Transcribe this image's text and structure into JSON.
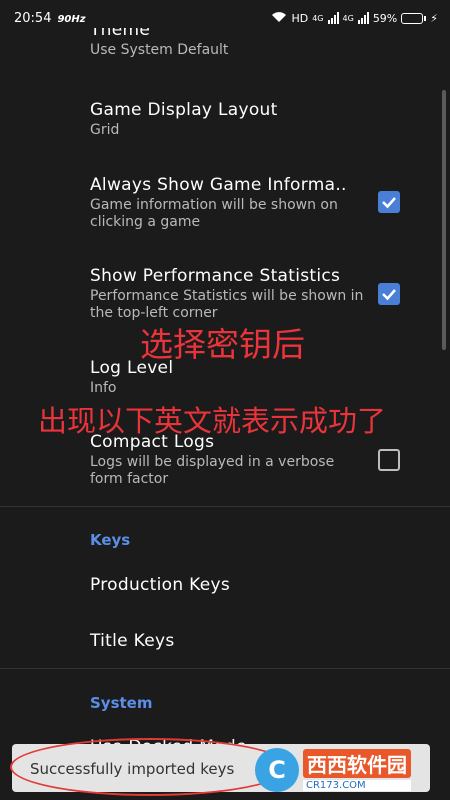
{
  "status_bar": {
    "time": "20:54",
    "refresh_rate": "90Hz",
    "network_label": "HD",
    "net_type_1": "4G",
    "net_type_2": "4G",
    "battery_percent": "59%",
    "battery_level": 0.59
  },
  "settings": {
    "theme": {
      "title": "Theme",
      "value": "Use System Default"
    },
    "game_display_layout": {
      "title": "Game Display Layout",
      "value": "Grid"
    },
    "always_show_game_info": {
      "title": "Always Show Game Informa..",
      "description": "Game information will be shown on clicking a game",
      "checked": true
    },
    "show_performance_stats": {
      "title": "Show Performance Statistics",
      "description": "Performance Statistics will be shown in the top-left corner",
      "checked": true
    },
    "log_level": {
      "title": "Log Level",
      "value": "Info"
    },
    "compact_logs": {
      "title": "Compact Logs",
      "description": "Logs will be displayed in a verbose form factor",
      "checked": false
    }
  },
  "keys_section": {
    "header": "Keys",
    "items": [
      "Production Keys",
      "Title Keys"
    ]
  },
  "system_section": {
    "header": "System",
    "partial_item": "Use Docked Mode"
  },
  "annotations": {
    "line1": "选择密钥后",
    "line2": "出现以下英文就表示成功了",
    "color": "#e8343a"
  },
  "toast": {
    "message": "Successfully imported keys"
  },
  "watermark": {
    "name": "西西软件园",
    "url": "CR173.COM"
  },
  "colors": {
    "background": "#1b1b1b",
    "accent": "#4a7fd6",
    "section_header": "#5b8ee6"
  }
}
